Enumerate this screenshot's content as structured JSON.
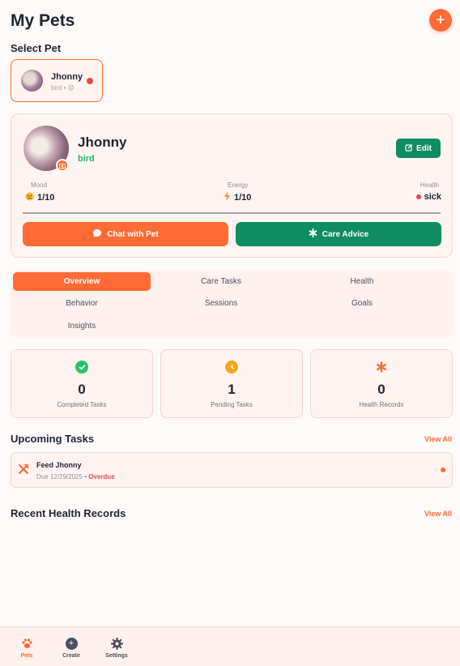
{
  "header": {
    "title": "My Pets",
    "add_icon": "plus-icon"
  },
  "select_pet": {
    "label": "Select Pet",
    "pets": [
      {
        "name": "Jhonny",
        "subtitle": "bird • 😟",
        "status_color": "#e34848"
      }
    ]
  },
  "pet_card": {
    "name": "Jhonny",
    "species": "bird",
    "edit_label": "Edit",
    "stats": {
      "mood": {
        "label": "Mood",
        "value": "1/10",
        "icon": "sad-face-icon"
      },
      "energy": {
        "label": "Energy",
        "value": "1/10",
        "icon": "lightning-icon"
      },
      "health": {
        "label": "Health",
        "value": "sick",
        "color": "#e34848"
      }
    },
    "chat_label": "Chat with Pet",
    "advice_label": "Care Advice"
  },
  "tabs": [
    "Overview",
    "Care Tasks",
    "Health",
    "Behavior",
    "Sessions",
    "Goals",
    "Insights"
  ],
  "active_tab": "Overview",
  "summary": [
    {
      "count": "0",
      "label": "Completed Tasks",
      "icon": "check-icon",
      "color": "#27c46a"
    },
    {
      "count": "1",
      "label": "Pending Tasks",
      "icon": "clock-icon",
      "color": "#f5a623"
    },
    {
      "count": "0",
      "label": "Health Records",
      "icon": "asterisk-icon",
      "color": "#fe6b35"
    }
  ],
  "upcoming": {
    "title": "Upcoming Tasks",
    "view_all": "View All",
    "tasks": [
      {
        "name": "Feed Jhonny",
        "due": "Due 12/29/2025 • ",
        "overdue": "Overdue",
        "icon": "utensils-icon"
      }
    ]
  },
  "health_records": {
    "title": "Recent Health Records",
    "view_all": "View All"
  },
  "nav": [
    {
      "label": "Pets",
      "icon": "paw-icon",
      "active": true
    },
    {
      "label": "Create",
      "icon": "plus-circle-icon",
      "active": false
    },
    {
      "label": "Settings",
      "icon": "gear-icon",
      "active": false
    }
  ],
  "colors": {
    "accent": "#fe6b35",
    "green": "#0f8c61",
    "species": "#27b46b"
  }
}
